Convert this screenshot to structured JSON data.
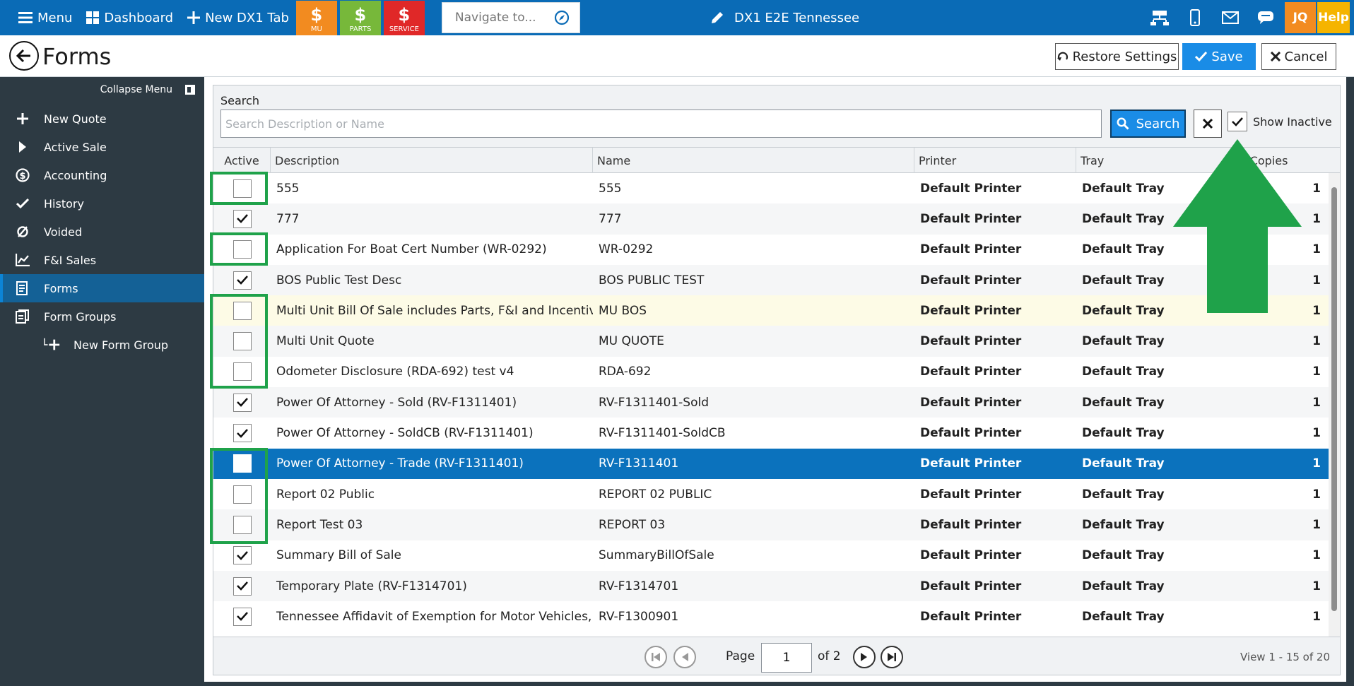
{
  "topbar": {
    "menu_label": "Menu",
    "dashboard_label": "Dashboard",
    "new_tab_label": "New DX1 Tab",
    "quick_mu": "MU",
    "quick_parts": "PARTS",
    "quick_service": "SERVICE",
    "navigate_placeholder": "Navigate to...",
    "title": "DX1 E2E Tennessee",
    "user_initials": "JQ",
    "help_label": "Help",
    "colors": {
      "bar": "#0a6bb6",
      "mu": "#f28b20",
      "parts": "#77b83a",
      "service": "#e02828",
      "jq": "#f28b20",
      "help": "#f5b400"
    }
  },
  "header": {
    "page_title": "Forms",
    "restore_label": "Restore Settings",
    "save_label": "Save",
    "cancel_label": "Cancel"
  },
  "sidebar": {
    "collapse_label": "Collapse Menu",
    "items": [
      {
        "label": "New Quote",
        "icon": "plus-icon"
      },
      {
        "label": "Active Sale",
        "icon": "play-icon"
      },
      {
        "label": "Accounting",
        "icon": "dollar-icon"
      },
      {
        "label": "History",
        "icon": "check-icon"
      },
      {
        "label": "Voided",
        "icon": "void-icon"
      },
      {
        "label": "F&I Sales",
        "icon": "chart-icon"
      },
      {
        "label": "Forms",
        "icon": "form-icon",
        "active": true
      },
      {
        "label": "Form Groups",
        "icon": "form-groups-icon"
      },
      {
        "label": "New Form Group",
        "icon": "plus-icon",
        "sub": true
      }
    ]
  },
  "search": {
    "label": "Search",
    "placeholder": "Search Description or Name",
    "value": "",
    "button_label": "Search",
    "show_inactive_label": "Show Inactive",
    "show_inactive_checked": true
  },
  "grid": {
    "columns": [
      "Active",
      "Description",
      "Name",
      "Printer",
      "Tray",
      "f Copies"
    ],
    "rows": [
      {
        "active": false,
        "description": "555",
        "name": "555",
        "printer": "Default Printer",
        "tray": "Default Tray",
        "copies": "1"
      },
      {
        "active": true,
        "description": "777",
        "name": "777",
        "printer": "Default Printer",
        "tray": "Default Tray",
        "copies": "1"
      },
      {
        "active": false,
        "description": "Application For Boat Cert Number (WR-0292)",
        "name": "WR-0292",
        "printer": "Default Printer",
        "tray": "Default Tray",
        "copies": "1"
      },
      {
        "active": true,
        "description": "BOS Public Test Desc",
        "name": "BOS PUBLIC TEST",
        "printer": "Default Printer",
        "tray": "Default Tray",
        "copies": "1"
      },
      {
        "active": false,
        "description": "Multi Unit Bill Of Sale includes Parts, F&I and Incentives",
        "name": "MU BOS",
        "printer": "Default Printer",
        "tray": "Default Tray",
        "copies": "1",
        "state": "hover"
      },
      {
        "active": false,
        "description": "Multi Unit Quote",
        "name": "MU QUOTE",
        "printer": "Default Printer",
        "tray": "Default Tray",
        "copies": "1"
      },
      {
        "active": false,
        "description": "Odometer Disclosure (RDA-692) test v4",
        "name": "RDA-692",
        "printer": "Default Printer",
        "tray": "Default Tray",
        "copies": "1"
      },
      {
        "active": true,
        "description": "Power Of Attorney - Sold (RV-F1311401)",
        "name": "RV-F1311401-Sold",
        "printer": "Default Printer",
        "tray": "Default Tray",
        "copies": "1"
      },
      {
        "active": true,
        "description": "Power Of Attorney - SoldCB (RV-F1311401)",
        "name": "RV-F1311401-SoldCB",
        "printer": "Default Printer",
        "tray": "Default Tray",
        "copies": "1"
      },
      {
        "active": false,
        "description": "Power Of Attorney - Trade (RV-F1311401)",
        "name": "RV-F1311401",
        "printer": "Default Printer",
        "tray": "Default Tray",
        "copies": "1",
        "state": "selected"
      },
      {
        "active": false,
        "description": "Report 02 Public",
        "name": "REPORT 02 PUBLIC",
        "printer": "Default Printer",
        "tray": "Default Tray",
        "copies": "1"
      },
      {
        "active": false,
        "description": "Report Test 03",
        "name": "REPORT 03",
        "printer": "Default Printer",
        "tray": "Default Tray",
        "copies": "1"
      },
      {
        "active": true,
        "description": "Summary Bill of Sale",
        "name": "SummaryBillOfSale",
        "printer": "Default Printer",
        "tray": "Default Tray",
        "copies": "1"
      },
      {
        "active": true,
        "description": "Temporary Plate (RV-F1314701)",
        "name": "RV-F1314701",
        "printer": "Default Printer",
        "tray": "Default Tray",
        "copies": "1"
      },
      {
        "active": true,
        "description": "Tennessee Affidavit of Exemption for Motor Vehicles, b...",
        "name": "RV-F1300901",
        "printer": "Default Printer",
        "tray": "Default Tray",
        "copies": "1"
      }
    ]
  },
  "pager": {
    "page_label": "Page",
    "page_value": "1",
    "of_label": "of 2",
    "view_label": "View 1 - 15 of 20"
  },
  "annotation_color": "#1fa24a"
}
